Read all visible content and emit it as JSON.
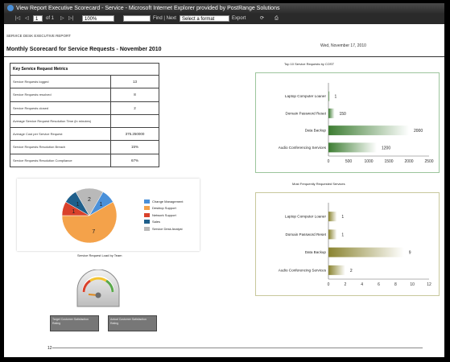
{
  "window": {
    "title": "View Report Executive Scorecard - Service - Microsoft Internet Explorer provided by PostRange Solutions"
  },
  "toolbar": {
    "page_current": "1",
    "page_of": "of 1",
    "zoom": "100%",
    "find_label": "Find | Next",
    "format_select": "Select a format",
    "export_label": "Export"
  },
  "report": {
    "label": "SERVICE DESK EXECUTIVE REPORT",
    "title": "Monthly Scorecard for Service Requests - November 2010",
    "date": "Wed, November 17, 2010"
  },
  "metrics": {
    "heading": "Key Service Request Metrics",
    "rows": [
      {
        "label": "Service Requests logged",
        "value": "13"
      },
      {
        "label": "Service Requests resolved",
        "value": "8"
      },
      {
        "label": "Service Requests closed",
        "value": "2"
      },
      {
        "label": "Average Service Request Resolution Time (in minutes)",
        "value": ""
      },
      {
        "label": "Average Cost per Service Request",
        "value": "375.250000"
      },
      {
        "label": "Service Requests Resolution Breach",
        "value": "15%"
      },
      {
        "label": "Service Requests Resolution Compliance",
        "value": "67%"
      }
    ]
  },
  "pie": {
    "title": "Service Request Load by Team",
    "legend": [
      "Change Management",
      "Desktop Support",
      "Network Support",
      "Sales",
      "Service Desk Analyst"
    ],
    "colors": [
      "#4a90d9",
      "#f4a24a",
      "#d9412b",
      "#1f5f8b",
      "#b9b9b9"
    ]
  },
  "gauge": {
    "boxes": [
      "Target Customer Satisfaction Rating",
      "Actual Customer Satisfaction Rating"
    ]
  },
  "footer": {
    "value": "12"
  },
  "chart_data": [
    {
      "type": "bar",
      "orientation": "horizontal",
      "title": "Top 10 Service Requests by COST",
      "categories": [
        "Laptop Computer Loaner",
        "Domain Password Reset",
        "Data Backup",
        "Audio Conferencing Services"
      ],
      "values": [
        1,
        150,
        2000,
        1200
      ],
      "xlim": [
        0,
        2500
      ],
      "xticks": [
        "0",
        "500",
        "1000",
        "1500",
        "2000",
        "2500"
      ],
      "color": "#3d7d32"
    },
    {
      "type": "bar",
      "orientation": "horizontal",
      "title": "Most Frequently Requested Services",
      "categories": [
        "Laptop Computer Loaner",
        "Domain Password Reset",
        "Data Backup",
        "Audio Conferencing Services"
      ],
      "values": [
        1,
        1,
        9,
        2
      ],
      "xlim": [
        0,
        12
      ],
      "xticks": [
        "0",
        "2",
        "4",
        "6",
        "8",
        "10",
        "12"
      ],
      "color": "#8a8430"
    },
    {
      "type": "pie",
      "title": "Service Request Load by Team",
      "categories": [
        "Change Management",
        "Desktop Support",
        "Network Support",
        "Sales",
        "Service Desk Analyst"
      ],
      "values": [
        1,
        7,
        1,
        1,
        2
      ]
    }
  ]
}
